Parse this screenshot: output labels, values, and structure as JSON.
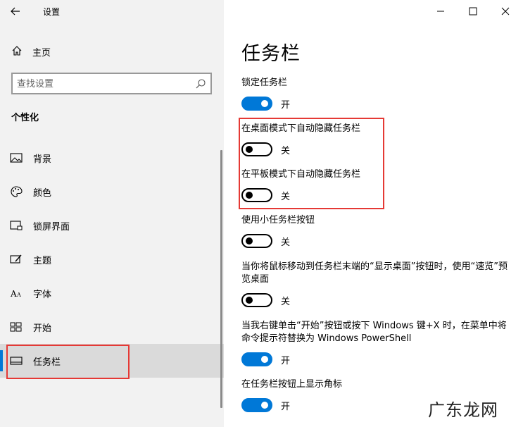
{
  "window": {
    "title": "设置",
    "controls": {
      "minimize": "minimize-icon",
      "maximize": "maximize-icon",
      "close": "close-icon"
    }
  },
  "sidebar": {
    "home_label": "主页",
    "search_placeholder": "查找设置",
    "section_title": "个性化",
    "items": [
      {
        "label": "背景",
        "icon": "image-icon"
      },
      {
        "label": "颜色",
        "icon": "palette-icon"
      },
      {
        "label": "锁屏界面",
        "icon": "lockscreen-icon"
      },
      {
        "label": "主题",
        "icon": "theme-brush-icon"
      },
      {
        "label": "字体",
        "icon": "font-icon"
      },
      {
        "label": "开始",
        "icon": "start-grid-icon"
      },
      {
        "label": "任务栏",
        "icon": "taskbar-icon",
        "selected": true
      }
    ]
  },
  "main": {
    "title": "任务栏",
    "settings": [
      {
        "label": "锁定任务栏",
        "on": true,
        "state": "开"
      },
      {
        "label": "在桌面模式下自动隐藏任务栏",
        "on": false,
        "state": "关"
      },
      {
        "label": "在平板模式下自动隐藏任务栏",
        "on": false,
        "state": "关"
      },
      {
        "label": "使用小任务栏按钮",
        "on": false,
        "state": "关"
      },
      {
        "label": "当你将鼠标移动到任务栏末端的“显示桌面”按钮时，使用“速览”预览桌面",
        "on": false,
        "state": "关"
      },
      {
        "label": "当我右键单击“开始”按钮或按下 Windows 键+X 时，在菜单中将命令提示符替换为 Windows PowerShell",
        "on": true,
        "state": "开"
      },
      {
        "label": "在任务栏按钮上显示角标",
        "on": true,
        "state": "开"
      }
    ]
  },
  "watermark": "广东龙网",
  "colors": {
    "accent": "#0078d7",
    "highlight_box": "#e53935",
    "sidebar_bg": "#f2f2f2"
  }
}
